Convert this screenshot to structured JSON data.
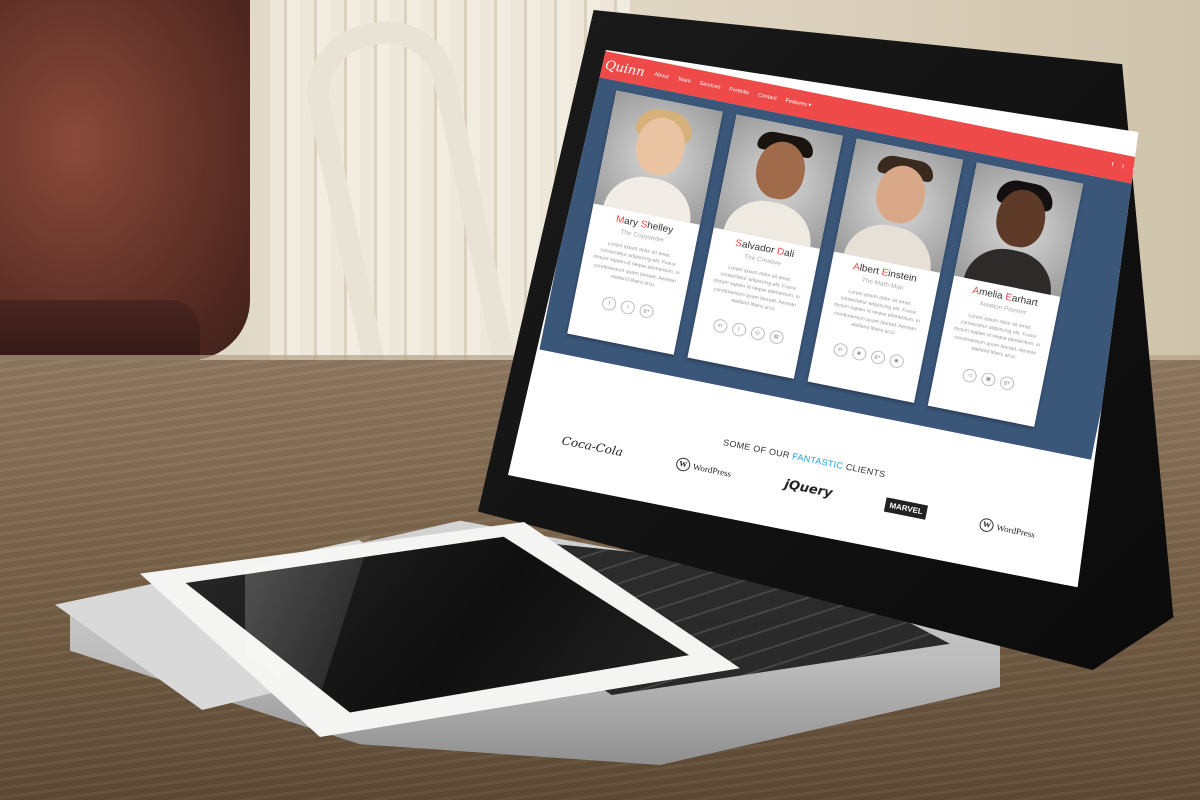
{
  "site": {
    "logo": "Quinn",
    "nav": [
      "About",
      "Team",
      "Services",
      "Portfolio",
      "Contact",
      "Features ▾"
    ],
    "social": [
      "f",
      "t",
      "g+"
    ]
  },
  "team": [
    {
      "first_initial": "M",
      "first_rest": "ary ",
      "last_initial": "S",
      "last_rest": "helley",
      "role": "The Copywriter",
      "bio": "Lorem ipsum dolor sit amet, consectetur adipiscing elit. Fusce dictum sapien id neque elementum, in condimentum quam laoreet. Aenean eleifend libero arcu.",
      "icons": [
        "f",
        "t",
        "g+"
      ]
    },
    {
      "first_initial": "S",
      "first_rest": "alvador ",
      "last_initial": "D",
      "last_rest": "ali",
      "role": "The Creative",
      "bio": "Lorem ipsum dolor sit amet, consectetur adipiscing elit. Fusce dictum sapien id neque elementum, in condimentum quam laoreet. Aenean eleifend libero arcu.",
      "icons": [
        "in",
        "t",
        "◎",
        "▤"
      ]
    },
    {
      "first_initial": "A",
      "first_rest": "lbert ",
      "last_initial": "E",
      "last_rest": "instein",
      "role": "The Math-Man",
      "bio": "Lorem ipsum dolor sit amet, consectetur adipiscing elit. Fusce dictum sapien id neque elementum, in condimentum quam laoreet. Aenean eleifend libero arcu.",
      "icons": [
        "in",
        "◙",
        "g+",
        "◉"
      ]
    },
    {
      "first_initial": "A",
      "first_rest": "melia ",
      "last_initial": "E",
      "last_rest": "arhart",
      "role": "Aviation Pioneer",
      "bio": "Lorem ipsum dolor sit amet, consectetur adipiscing elit. Fusce dictum sapien id neque elementum, in condimentum quam laoreet. Aenean eleifend libero arcu.",
      "icons": [
        "◁",
        "▣",
        "g+"
      ]
    }
  ],
  "clients": {
    "title_pre": "SOME OF OUR ",
    "title_hl": "FANTASTIC",
    "title_post": " CLIENTS",
    "logos": [
      "Coca-Cola",
      "WordPress",
      "jQuery",
      "MARVEL",
      "WordPress"
    ]
  },
  "colors": {
    "navbar": "#ef4a4a",
    "team_bg": "#3a5679",
    "accent": "#1ba1e2",
    "name_initial": "#ef4a4a"
  }
}
